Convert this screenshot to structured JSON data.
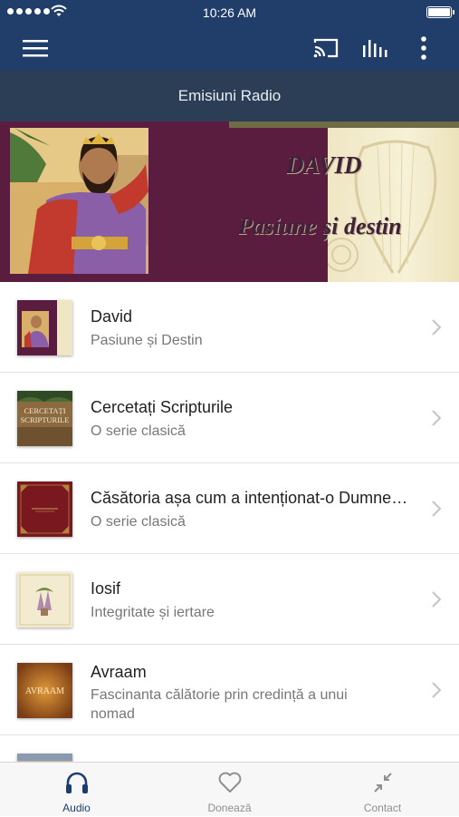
{
  "status_bar": {
    "time": "10:26 AM"
  },
  "header": {
    "subtitle": "Emisiuni Radio"
  },
  "banner": {
    "title": "DAVID",
    "subtitle": "Pasiune și destin"
  },
  "series": [
    {
      "title": "David",
      "subtitle": "Pasiune și Destin",
      "thumb": "david"
    },
    {
      "title": "Cercetați Scripturile",
      "subtitle": "O serie clasică",
      "thumb": "cercetati",
      "thumb_text": [
        "CERCETAȚI",
        "SCRIPTURILE"
      ]
    },
    {
      "title": "Căsătoria așa cum a intenționat-o Dumnezeu",
      "subtitle": "O serie clasică",
      "thumb": "casatoria"
    },
    {
      "title": "Iosif",
      "subtitle": "Integritate și iertare",
      "thumb": "iosif"
    },
    {
      "title": "Avraam",
      "subtitle": "Fascinanta călătorie prin credință a unui nomad",
      "thumb": "avraam",
      "thumb_text": [
        "AVRAAM"
      ]
    }
  ],
  "tabs": [
    {
      "label": "Audio",
      "icon": "headphones-icon",
      "active": true
    },
    {
      "label": "Donează",
      "icon": "heart-icon",
      "active": false
    },
    {
      "label": "Contact",
      "icon": "collapse-arrows-icon",
      "active": false
    }
  ],
  "colors": {
    "primary": "#213e6b",
    "subheader": "#2c3e56",
    "active_tab": "#1c3d6e",
    "inactive_tab": "#8e8e93"
  }
}
